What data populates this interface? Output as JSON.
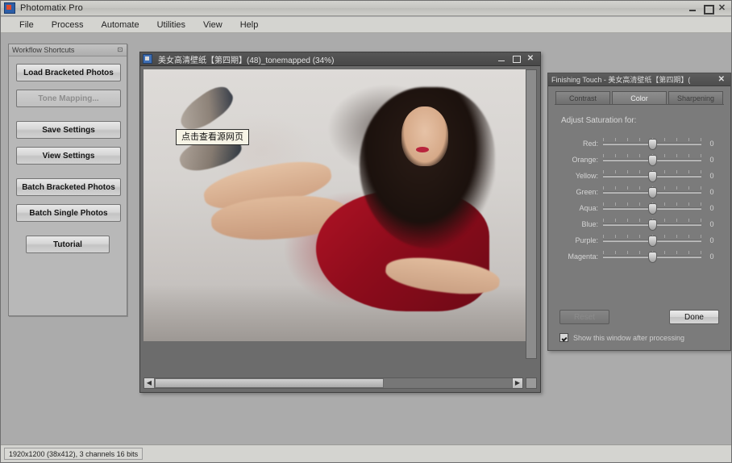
{
  "app": {
    "title": "Photomatix Pro",
    "icon": "app-icon",
    "window_controls": {
      "minimize": "–",
      "maximize": "□",
      "close": "✕"
    }
  },
  "menubar": {
    "items": [
      {
        "label": "File"
      },
      {
        "label": "Process"
      },
      {
        "label": "Automate"
      },
      {
        "label": "Utilities"
      },
      {
        "label": "View"
      },
      {
        "label": "Help"
      }
    ]
  },
  "workflow_panel": {
    "title": "Workflow Shortcuts",
    "pin_icon": "⊡",
    "buttons": [
      {
        "label": "Load Bracketed Photos",
        "disabled": false
      },
      {
        "label": "Tone Mapping...",
        "disabled": true
      },
      {
        "label": "Save Settings",
        "disabled": false
      },
      {
        "label": "View Settings",
        "disabled": false
      },
      {
        "label": "Batch Bracketed Photos",
        "disabled": false
      },
      {
        "label": "Batch Single Photos",
        "disabled": false
      },
      {
        "label": "Tutorial",
        "disabled": false
      }
    ]
  },
  "document_window": {
    "title": "美女高清壁纸【第四期】(48)_tonemapped (34%)",
    "zoom_percent": "34%",
    "tooltip": "点击查看源网页",
    "window_controls": {
      "minimize": "–",
      "maximize": "□",
      "close": "✕"
    },
    "scroll": {
      "left_arrow": "◀",
      "right_arrow": "▶",
      "thumb_position_percent": 0,
      "thumb_width_percent": 64
    }
  },
  "finishing_touch": {
    "title": "Finishing Touch - 美女高清壁纸【第四期】(",
    "close_icon": "✕",
    "tabs": [
      {
        "label": "Contrast",
        "active": false
      },
      {
        "label": "Color",
        "active": true
      },
      {
        "label": "Sharpening",
        "active": false
      }
    ],
    "section_label": "Adjust Saturation for:",
    "sliders": [
      {
        "name": "Red:",
        "value": "0",
        "position_percent": 50
      },
      {
        "name": "Orange:",
        "value": "0",
        "position_percent": 50
      },
      {
        "name": "Yellow:",
        "value": "0",
        "position_percent": 50
      },
      {
        "name": "Green:",
        "value": "0",
        "position_percent": 50
      },
      {
        "name": "Aqua:",
        "value": "0",
        "position_percent": 50
      },
      {
        "name": "Blue:",
        "value": "0",
        "position_percent": 50
      },
      {
        "name": "Purple:",
        "value": "0",
        "position_percent": 50
      },
      {
        "name": "Magenta:",
        "value": "0",
        "position_percent": 50
      }
    ],
    "reset_label": "Reset",
    "reset_disabled": true,
    "done_label": "Done",
    "checkbox_label": "Show this window after processing",
    "checkbox_checked": true
  },
  "statusbar": {
    "text": "1920x1200 (38x412), 3 channels 16 bits"
  },
  "colors": {
    "window_chrome": "#d4d4d0",
    "workspace_bg": "#ababab",
    "panel_dark": "#7b7b7b",
    "doc_frame": "#6c6c6c",
    "accent_red": "#b01325"
  }
}
